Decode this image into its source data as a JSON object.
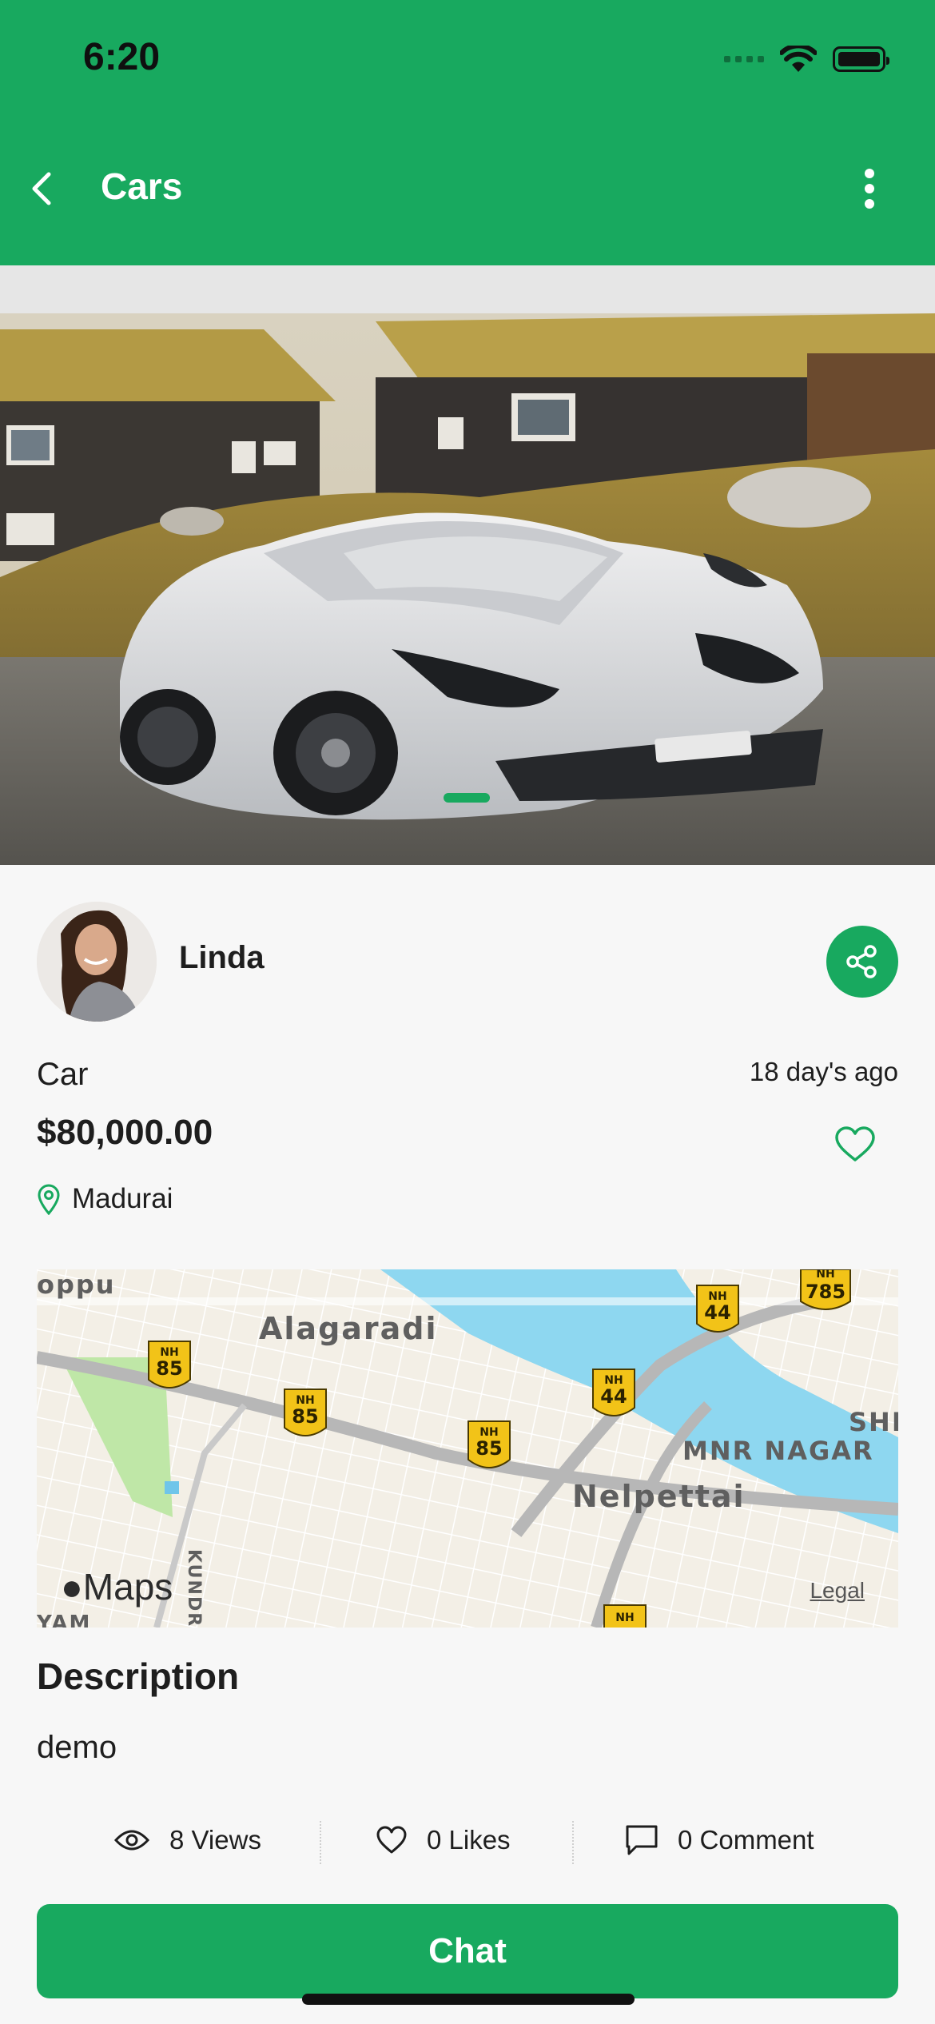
{
  "status_bar": {
    "time": "6:20"
  },
  "header": {
    "title": "Cars"
  },
  "seller": {
    "name": "Linda"
  },
  "product": {
    "title": "Car",
    "posted": "18 day's ago",
    "price": "$80,000.00",
    "location": "Madurai"
  },
  "map": {
    "labels": [
      "oppu",
      "Alagaradi",
      "MNR NAGAR",
      "Nelpettai",
      "SHE",
      "KUNDRA",
      "YAM"
    ],
    "highway_shields": [
      "NH 85",
      "NH 85",
      "NH 85",
      "NH 44",
      "NH 44",
      "NH 785",
      "NH"
    ],
    "provider": "Maps",
    "legal": "Legal"
  },
  "description": {
    "heading": "Description",
    "text": "demo"
  },
  "stats": {
    "views": "8 Views",
    "likes": "0 Likes",
    "comments": "0 Comment"
  },
  "actions": {
    "chat": "Chat"
  },
  "colors": {
    "primary": "#18a95f",
    "water": "#8ed7f0",
    "road": "#b7b7b7",
    "shield": "#f2c318"
  }
}
